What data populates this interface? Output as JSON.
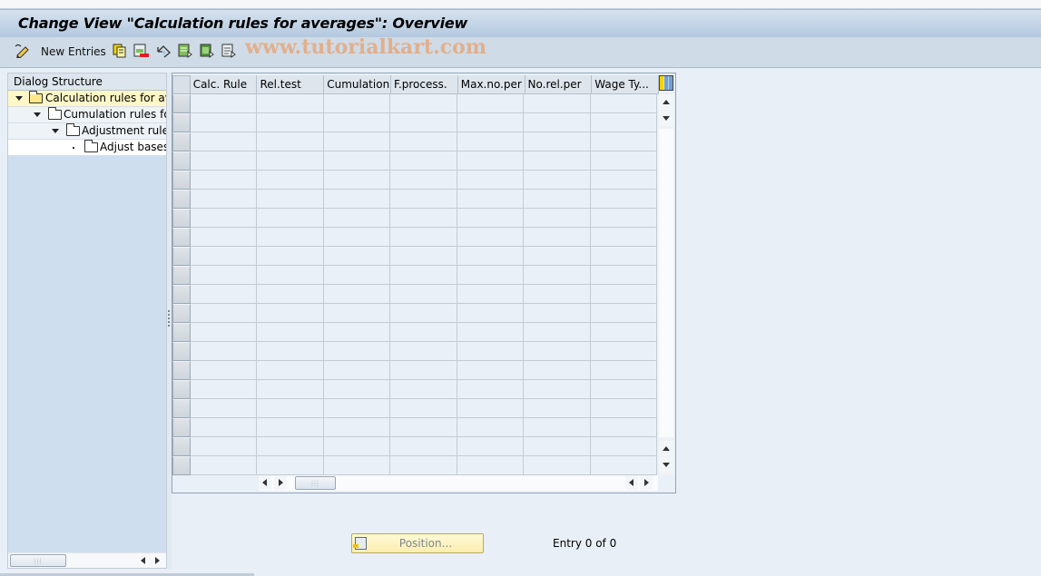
{
  "header": {
    "title": "Change View \"Calculation rules for averages\": Overview"
  },
  "toolbar": {
    "items": [
      {
        "icon": "edit-pencil-icon"
      },
      {
        "label": "New Entries"
      },
      {
        "icon": "copy-icon"
      },
      {
        "icon": "delete-icon"
      },
      {
        "icon": "undo-icon"
      },
      {
        "icon": "select-all-icon"
      },
      {
        "icon": "select-block-icon"
      },
      {
        "icon": "deselect-all-icon"
      }
    ],
    "watermark": "www.tutorialkart.com"
  },
  "dialog_structure": {
    "title": "Dialog Structure",
    "items": [
      {
        "label": "Calculation rules for aver",
        "level": 0,
        "expanded": true,
        "selected": true
      },
      {
        "label": "Cumulation rules for",
        "level": 1,
        "expanded": true,
        "selected": false
      },
      {
        "label": "Adjustment rules",
        "level": 2,
        "expanded": true,
        "selected": false
      },
      {
        "label": "Adjust bases",
        "level": 3,
        "expanded": false,
        "selected": false
      }
    ]
  },
  "table": {
    "columns": [
      "Calc. Rule",
      "Rel.test",
      "Cumulation",
      "F.process.",
      "Max.no.per",
      "No.rel.per",
      "Wage Ty..."
    ],
    "row_count": 20,
    "rows": []
  },
  "footer": {
    "position_button": "Position...",
    "entry_info": "Entry 0 of 0"
  }
}
